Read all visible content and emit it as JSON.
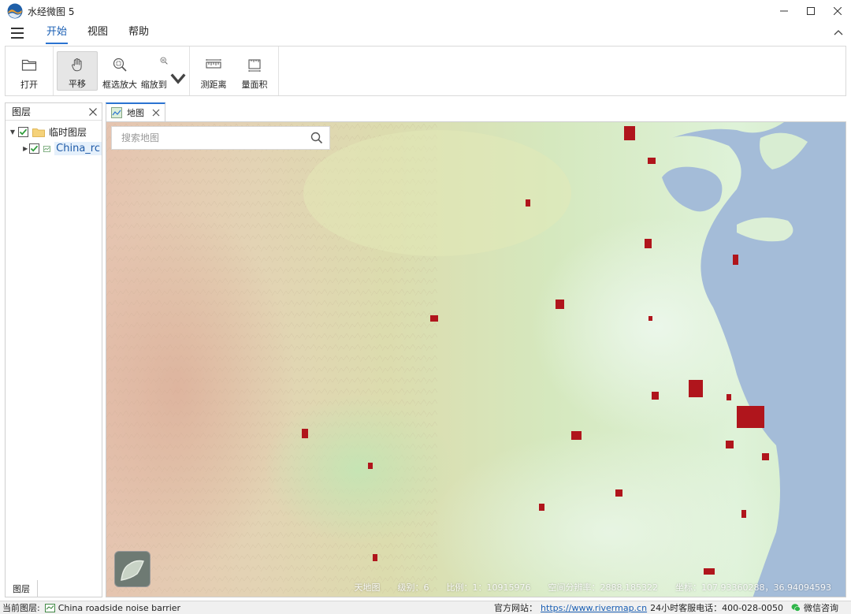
{
  "app": {
    "title": "水经微图 5"
  },
  "menu": {
    "items": [
      {
        "label": "开始",
        "active": true
      },
      {
        "label": "视图",
        "active": false
      },
      {
        "label": "帮助",
        "active": false
      }
    ]
  },
  "ribbon": {
    "open": "打开",
    "pan": "平移",
    "zoom_box": "框选放大",
    "zoom_to": "缩放到",
    "measure_distance": "测距离",
    "measure_area": "量面积"
  },
  "layer_panel": {
    "title": "图层",
    "tab_label": "图层",
    "tree": [
      {
        "label": "临时图层",
        "type": "folder",
        "checked": true,
        "expanded": true
      },
      {
        "label": "China_rc",
        "type": "layer",
        "checked": true,
        "expanded": false
      }
    ]
  },
  "map_tab": {
    "label": "地图"
  },
  "map": {
    "search_placeholder": "搜索地图",
    "info": {
      "source": "天地图",
      "level": "级别：6",
      "scale": "比例：1：10915976",
      "resolution": "空间分辨率：2888.185322",
      "coords": "坐标：107.93360288，36.94094593"
    }
  },
  "status": {
    "current_layer_label": "当前图层:",
    "current_layer_value": "China roadside noise barrier",
    "website_label": "官方网站：",
    "website_url": "https://www.rivermap.cn",
    "hotline": "24小时客服电话：400-028-0050",
    "wechat": "微信咨询"
  },
  "colors": {
    "accent": "#2b73d1",
    "feature": "#b0151c",
    "sea": "#9fb6d3"
  }
}
